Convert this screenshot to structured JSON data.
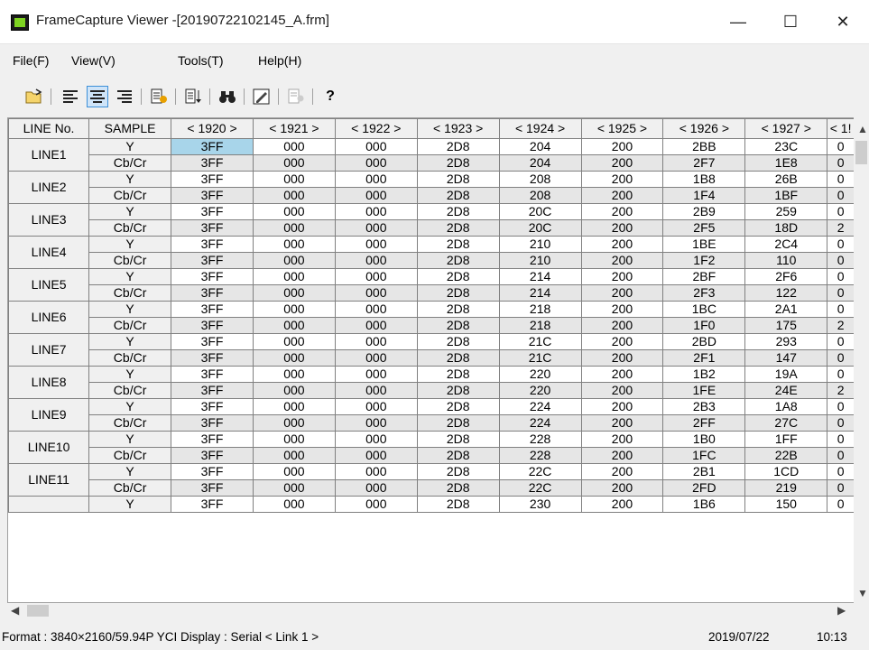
{
  "window": {
    "title": "FrameCapture Viewer -[20190722102145_A.frm]",
    "minimize": "—",
    "maximize": "☐",
    "close": "✕"
  },
  "menu": [
    "File(F)",
    "View(V)",
    "Tools(T)",
    "Help(H)"
  ],
  "columns": [
    "LINE No.",
    "SAMPLE",
    "< 1920 >",
    "< 1921 >",
    "< 1922 >",
    "< 1923 >",
    "< 1924 >",
    "< 1925 >",
    "< 1926 >",
    "< 1927 >",
    "< 1!"
  ],
  "sample_labels": {
    "y": "Y",
    "cbcr": "Cb/Cr"
  },
  "rows": [
    {
      "line": "LINE1",
      "y": [
        "3FF",
        "000",
        "000",
        "2D8",
        "204",
        "200",
        "2BB",
        "23C",
        "0"
      ],
      "cbcr": [
        "3FF",
        "000",
        "000",
        "2D8",
        "204",
        "200",
        "2F7",
        "1E8",
        "0"
      ]
    },
    {
      "line": "LINE2",
      "y": [
        "3FF",
        "000",
        "000",
        "2D8",
        "208",
        "200",
        "1B8",
        "26B",
        "0"
      ],
      "cbcr": [
        "3FF",
        "000",
        "000",
        "2D8",
        "208",
        "200",
        "1F4",
        "1BF",
        "0"
      ]
    },
    {
      "line": "LINE3",
      "y": [
        "3FF",
        "000",
        "000",
        "2D8",
        "20C",
        "200",
        "2B9",
        "259",
        "0"
      ],
      "cbcr": [
        "3FF",
        "000",
        "000",
        "2D8",
        "20C",
        "200",
        "2F5",
        "18D",
        "2"
      ]
    },
    {
      "line": "LINE4",
      "y": [
        "3FF",
        "000",
        "000",
        "2D8",
        "210",
        "200",
        "1BE",
        "2C4",
        "0"
      ],
      "cbcr": [
        "3FF",
        "000",
        "000",
        "2D8",
        "210",
        "200",
        "1F2",
        "110",
        "0"
      ]
    },
    {
      "line": "LINE5",
      "y": [
        "3FF",
        "000",
        "000",
        "2D8",
        "214",
        "200",
        "2BF",
        "2F6",
        "0"
      ],
      "cbcr": [
        "3FF",
        "000",
        "000",
        "2D8",
        "214",
        "200",
        "2F3",
        "122",
        "0"
      ]
    },
    {
      "line": "LINE6",
      "y": [
        "3FF",
        "000",
        "000",
        "2D8",
        "218",
        "200",
        "1BC",
        "2A1",
        "0"
      ],
      "cbcr": [
        "3FF",
        "000",
        "000",
        "2D8",
        "218",
        "200",
        "1F0",
        "175",
        "2"
      ]
    },
    {
      "line": "LINE7",
      "y": [
        "3FF",
        "000",
        "000",
        "2D8",
        "21C",
        "200",
        "2BD",
        "293",
        "0"
      ],
      "cbcr": [
        "3FF",
        "000",
        "000",
        "2D8",
        "21C",
        "200",
        "2F1",
        "147",
        "0"
      ]
    },
    {
      "line": "LINE8",
      "y": [
        "3FF",
        "000",
        "000",
        "2D8",
        "220",
        "200",
        "1B2",
        "19A",
        "0"
      ],
      "cbcr": [
        "3FF",
        "000",
        "000",
        "2D8",
        "220",
        "200",
        "1FE",
        "24E",
        "2"
      ]
    },
    {
      "line": "LINE9",
      "y": [
        "3FF",
        "000",
        "000",
        "2D8",
        "224",
        "200",
        "2B3",
        "1A8",
        "0"
      ],
      "cbcr": [
        "3FF",
        "000",
        "000",
        "2D8",
        "224",
        "200",
        "2FF",
        "27C",
        "0"
      ]
    },
    {
      "line": "LINE10",
      "y": [
        "3FF",
        "000",
        "000",
        "2D8",
        "228",
        "200",
        "1B0",
        "1FF",
        "0"
      ],
      "cbcr": [
        "3FF",
        "000",
        "000",
        "2D8",
        "228",
        "200",
        "1FC",
        "22B",
        "0"
      ]
    },
    {
      "line": "LINE11",
      "y": [
        "3FF",
        "000",
        "000",
        "2D8",
        "22C",
        "200",
        "2B1",
        "1CD",
        "0"
      ],
      "cbcr": [
        "3FF",
        "000",
        "000",
        "2D8",
        "22C",
        "200",
        "2FD",
        "219",
        "0"
      ]
    }
  ],
  "partial_row": [
    "3FF",
    "000",
    "000",
    "2D8",
    "230",
    "200",
    "1B6",
    "150",
    "0"
  ],
  "status": {
    "format": "Format : 3840×2160/59.94P YCI Display : Serial < Link 1 >",
    "date": "2019/07/22",
    "time": "10:13"
  },
  "colors": {
    "selection": "#a8d5ea",
    "cbcr_row": "#e6e6e6",
    "header": "#f0f0f0"
  }
}
